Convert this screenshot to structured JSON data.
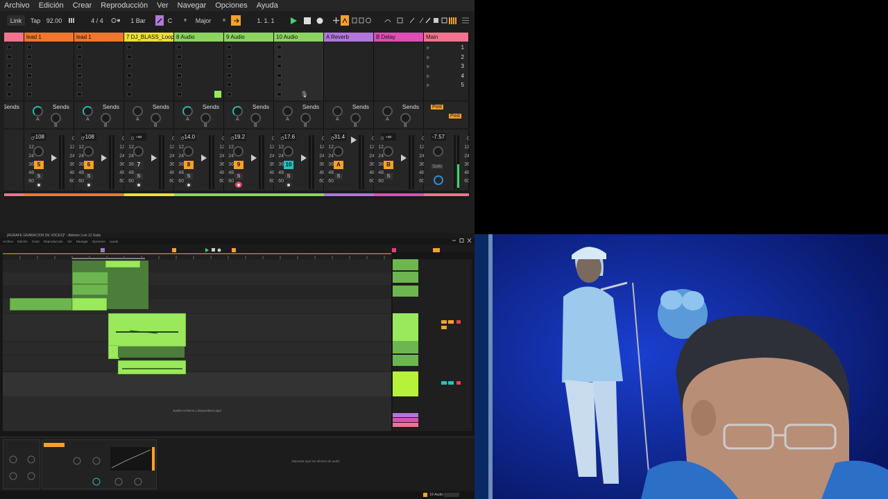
{
  "menu": [
    "Archivo",
    "Edición",
    "Crear",
    "Reproducción",
    "Ver",
    "Navegar",
    "Opciones",
    "Ayuda"
  ],
  "transport": {
    "link": "Link",
    "tap": "Tap",
    "tempo": "92.00",
    "signature": "4 / 4",
    "quant": "1 Bar",
    "key": "C",
    "scale": "Major",
    "position": "1.   1.   1"
  },
  "tracks": [
    {
      "name": "",
      "color": "#f0748e",
      "volume": "",
      "number": ""
    },
    {
      "name": "lead 1",
      "color": "#f0772c",
      "volume": "-108",
      "number": "5",
      "numColor": "#f7a02a"
    },
    {
      "name": "lead 1",
      "color": "#f0772c",
      "volume": "-108",
      "number": "6",
      "numColor": "#f7a02a"
    },
    {
      "name": "7 DJ_BLASS_Loop",
      "color": "#ede035",
      "volume": "-∞",
      "number": "7",
      "numColor": "#2d2d2d"
    },
    {
      "name": "8 Audio",
      "color": "#8ed460",
      "volume": "-14.0",
      "number": "8",
      "numColor": "#f7a02a"
    },
    {
      "name": "9 Audio",
      "color": "#8ed460",
      "volume": "-19.2",
      "number": "9",
      "numColor": "#f7a02a"
    },
    {
      "name": "10 Audio",
      "color": "#8ed460",
      "volume": "-17.6",
      "number": "10",
      "numColor": "#21c4c4"
    },
    {
      "name": "A Reverb",
      "color": "#b177dc",
      "volume": "-31.4",
      "number": "A",
      "numColor": "#f7a02a"
    },
    {
      "name": "B Delay",
      "color": "#dd4fb4",
      "volume": "-∞",
      "number": "B",
      "numColor": "#f7a02a"
    },
    {
      "name": "Main",
      "color": "#f0748e",
      "volume": "-7.57",
      "number": "",
      "numColor": ""
    }
  ],
  "sends_label": "Sends",
  "send_a": "A",
  "send_b": "B",
  "post_label": "Post",
  "solo_label": "Solo",
  "solo_btn": "S",
  "scene_numbers": [
    "1",
    "2",
    "3",
    "4",
    "5"
  ],
  "meter_scale": [
    "0",
    "12",
    "24",
    "36",
    "48",
    "60"
  ],
  "colors": {
    "accent": "#f7a02a",
    "background": "#1e1e1e",
    "clip_green": "#9ae85c"
  },
  "sub": {
    "title": "[AGRAFE GRABACION DE VOCES]* - Ableton Live 12 Suite",
    "menu": [
      "Archivo",
      "Edición",
      "Crear",
      "Reproducción",
      "Ver",
      "Navegar",
      "Opciones",
      "Ayuda"
    ],
    "drop_text": "Suelta Archivos y Dispositivos aquí",
    "device_drop": "Deposita aquí los efectos de audio",
    "status_track": "10-Audio"
  }
}
